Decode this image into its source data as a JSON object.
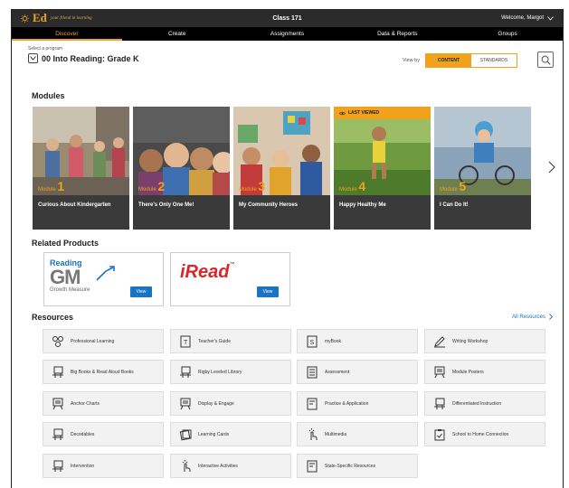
{
  "app": {
    "logo": "Ed",
    "tagline": "your friend in learning",
    "class_name": "Class 171",
    "welcome": "Welcome, Margot"
  },
  "nav": [
    "Discover",
    "Create",
    "Assignments",
    "Data & Reports",
    "Groups"
  ],
  "program": {
    "label": "Select a program",
    "name": "00 Into Reading: Grade K"
  },
  "view_by": {
    "label": "View by",
    "options": [
      "CONTENT",
      "STANDARDS"
    ],
    "selected": "CONTENT"
  },
  "modules_title": "Modules",
  "modules": [
    {
      "prefix": "Module",
      "number": "1",
      "title": "Curious About Kindergarten",
      "last_viewed": false
    },
    {
      "prefix": "Module",
      "number": "2",
      "title": "There's Only One Me!",
      "last_viewed": false
    },
    {
      "prefix": "Module",
      "number": "3",
      "title": "My Community Heroes",
      "last_viewed": false
    },
    {
      "prefix": "Module",
      "number": "4",
      "title": "Happy Healthy Me",
      "last_viewed": true
    },
    {
      "prefix": "Module",
      "number": "5",
      "title": "I Can Do It!",
      "last_viewed": false
    }
  ],
  "last_viewed_label": "LAST VIEWED",
  "related_title": "Related Products",
  "products": [
    {
      "logo_top": "Reading",
      "logo_main": "GM",
      "logo_sub": "Growth Measure",
      "button": "View"
    },
    {
      "logo_main": "iRead",
      "tm": "™",
      "button": "View"
    }
  ],
  "resources_title": "Resources",
  "all_resources": "All Resources",
  "resources": [
    {
      "label": "Professional Learning",
      "icon": "people-network-icon"
    },
    {
      "label": "Teacher's Guide",
      "icon": "teacher-guide-icon"
    },
    {
      "label": "myBook",
      "icon": "book-icon"
    },
    {
      "label": "Writing Workshop",
      "icon": "pencil-icon"
    },
    {
      "label": "Big Books & Read Aloud Books",
      "icon": "books-icon"
    },
    {
      "label": "Rigby Leveled Library",
      "icon": "library-icon"
    },
    {
      "label": "Assessment",
      "icon": "checklist-icon"
    },
    {
      "label": "Module Posters",
      "icon": "easel-icon"
    },
    {
      "label": "Anchor Charts",
      "icon": "chart-easel-icon"
    },
    {
      "label": "Display & Engage",
      "icon": "display-icon"
    },
    {
      "label": "Practice & Application",
      "icon": "worksheet-icon"
    },
    {
      "label": "Differentiated Instruction",
      "icon": "differentiated-icon"
    },
    {
      "label": "Decodables",
      "icon": "decodable-book-icon"
    },
    {
      "label": "Learning Cards",
      "icon": "cards-icon"
    },
    {
      "label": "Multimedia",
      "icon": "touch-icon"
    },
    {
      "label": "School to Home Connection",
      "icon": "clipboard-check-icon"
    },
    {
      "label": "Intervention",
      "icon": "intervention-book-icon"
    },
    {
      "label": "Interactive Activities",
      "icon": "tap-icon"
    },
    {
      "label": "State-Specific Resources",
      "icon": "state-doc-icon"
    }
  ],
  "colors": {
    "accent": "#f0a21c",
    "link": "#1a74c6",
    "topbar": "#2b2b2b"
  }
}
